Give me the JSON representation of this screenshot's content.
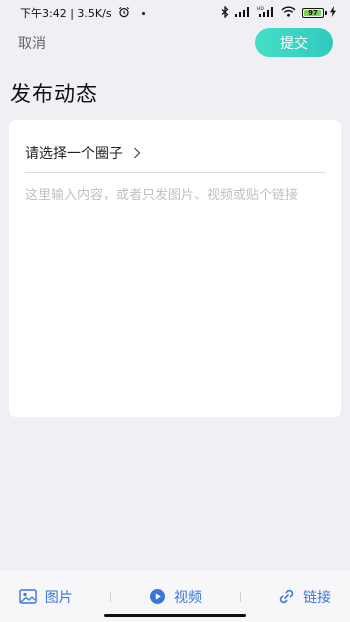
{
  "status_bar": {
    "left_text": "下午3:42 | 3.5K/s",
    "battery_level": "97",
    "icons": [
      "alarm-icon",
      "bluetooth-icon",
      "signal-icon",
      "hd-signal-icon",
      "wifi-icon",
      "battery-icon",
      "charging-icon"
    ]
  },
  "header": {
    "cancel_label": "取消",
    "submit_label": "提交",
    "title": "发布动态"
  },
  "form": {
    "circle_select_label": "请选择一个圈子",
    "content_placeholder": "这里输入内容，或者只发图片、视频或贴个链接",
    "content_value": ""
  },
  "toolbar": {
    "items": [
      {
        "label": "图片",
        "icon": "image-icon"
      },
      {
        "label": "视频",
        "icon": "video-play-icon"
      },
      {
        "label": "链接",
        "icon": "link-icon"
      }
    ]
  },
  "colors": {
    "accent": "#3a77d9",
    "submit_gradient_start": "#43e0c8",
    "submit_gradient_end": "#31c9be",
    "background": "#efeff4",
    "card": "#ffffff"
  }
}
